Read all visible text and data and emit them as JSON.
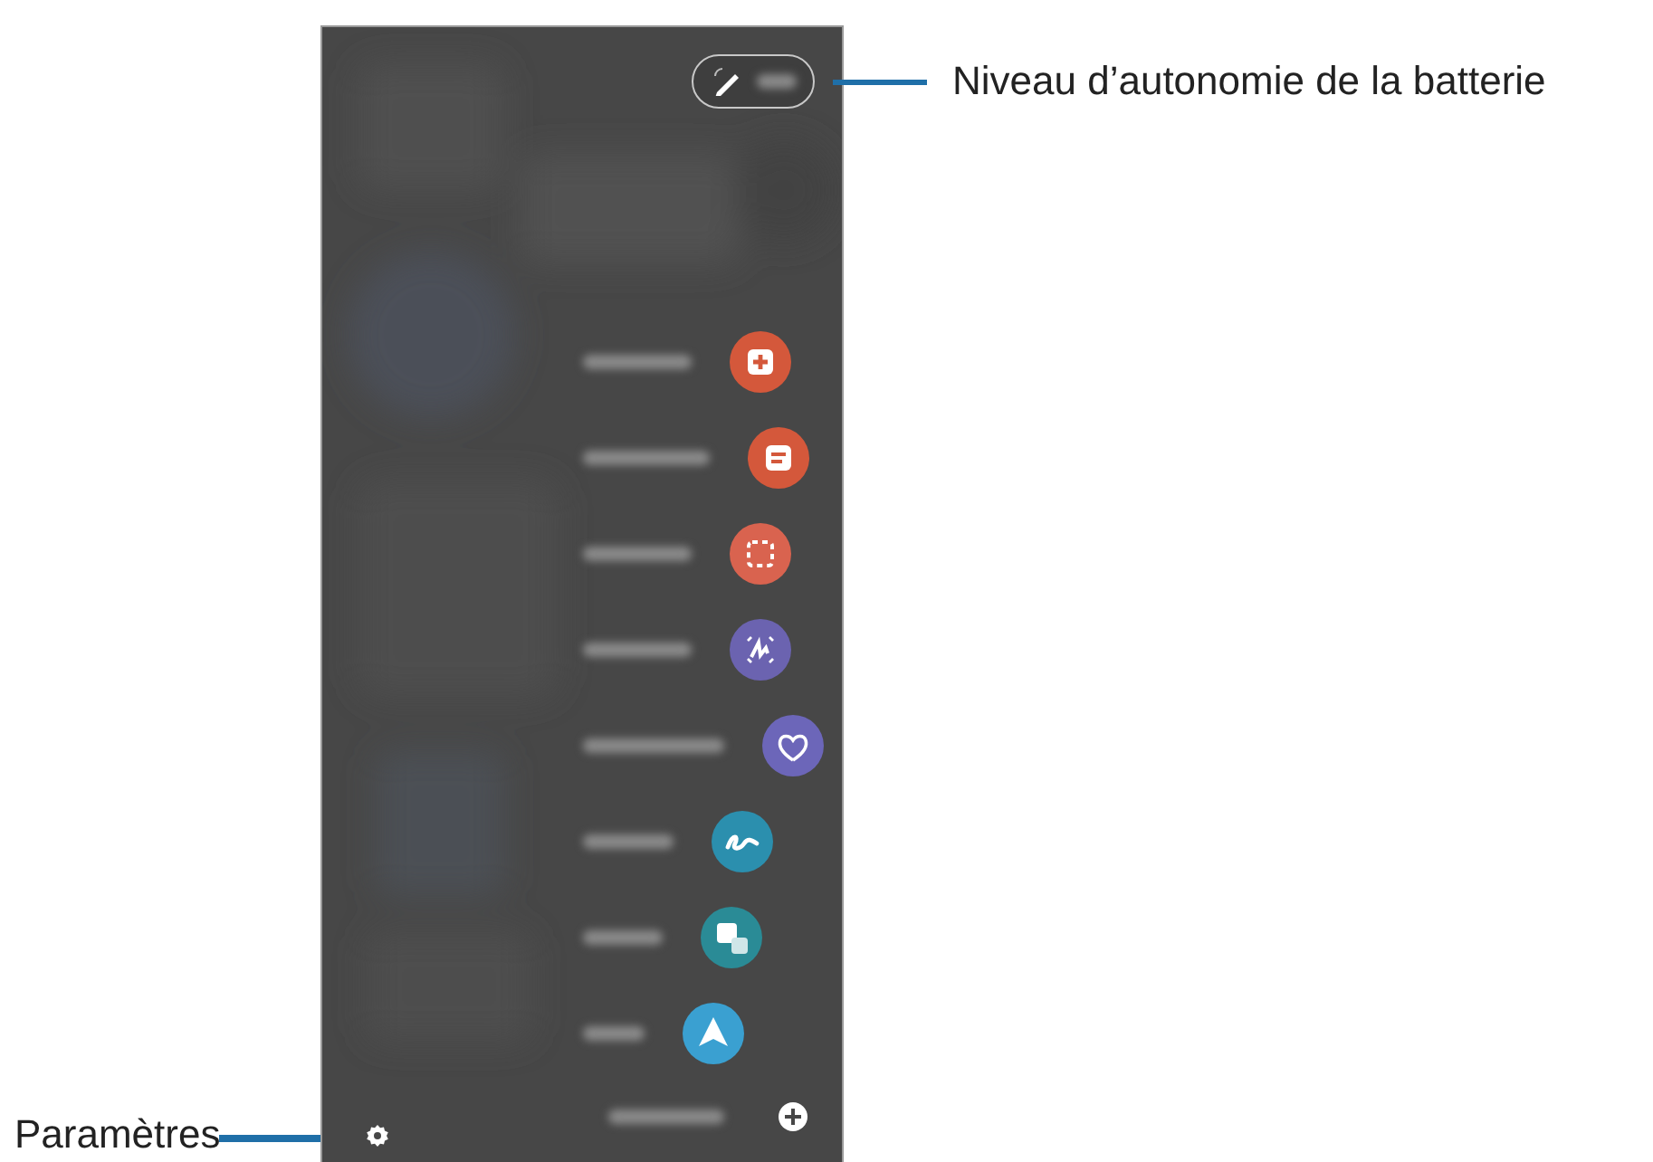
{
  "callouts": [
    {
      "kind": "battery",
      "text": "Niveau d’autonomie de la batterie"
    },
    {
      "kind": "settings",
      "text": "Paramètres"
    }
  ],
  "menu_items": [
    {
      "kind": "note-plus",
      "color": "#d4583b"
    },
    {
      "kind": "note",
      "color": "#d4583b"
    },
    {
      "kind": "select",
      "color": "#d9634f"
    },
    {
      "kind": "write",
      "color": "#6b63b0"
    },
    {
      "kind": "heart",
      "color": "#6c66b9"
    },
    {
      "kind": "squiggle",
      "color": "#2b8fae"
    },
    {
      "kind": "translate",
      "color": "#2a8b96"
    },
    {
      "kind": "pin",
      "color": "#3aa0d1"
    },
    {
      "kind": "add",
      "color": "#ffffff"
    }
  ]
}
